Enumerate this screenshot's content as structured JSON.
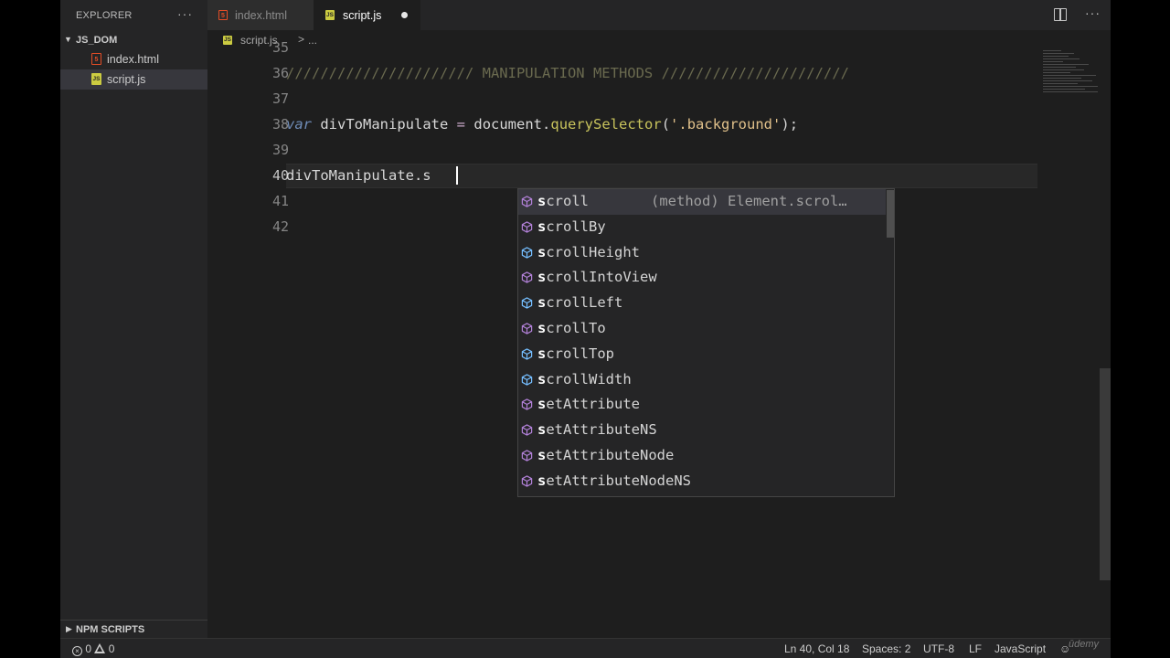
{
  "sidebar": {
    "title": "EXPLORER",
    "more": "···",
    "folder": "JS_DOM",
    "files": [
      {
        "name": "index.html",
        "icon": "html-icon",
        "glyph": "5"
      },
      {
        "name": "script.js",
        "icon": "js-icon",
        "glyph": "JS"
      }
    ],
    "npm_scripts": "NPM SCRIPTS"
  },
  "tabs": [
    {
      "label": "index.html",
      "glyph": "5",
      "active": false
    },
    {
      "label": "script.js",
      "glyph": "JS",
      "active": true,
      "modified": true
    }
  ],
  "tabs_more": "···",
  "breadcrumb": {
    "file": "script.js",
    "glyph": "JS",
    "separator": ">",
    "more": "..."
  },
  "editor": {
    "partial_line_number": "35",
    "lines": [
      {
        "n": "36"
      },
      {
        "n": "37"
      },
      {
        "n": "38"
      },
      {
        "n": "39"
      },
      {
        "n": "40"
      },
      {
        "n": "41"
      },
      {
        "n": "42"
      }
    ],
    "line36_comment": "////////////////////// MANIPULATION METHODS //////////////////////",
    "line38": {
      "kw": "var",
      "name": "divToManipulate",
      "eq": "=",
      "obj": "document",
      "dot": ".",
      "fn": "querySelector",
      "open": "(",
      "str": "'.background'",
      "close": ");"
    },
    "line40": "divToManipulate.s"
  },
  "suggest": {
    "items": [
      {
        "rest": "croll",
        "kind": "method",
        "detail": "(method) Element.scrol…"
      },
      {
        "rest": "crollBy",
        "kind": "method"
      },
      {
        "rest": "crollHeight",
        "kind": "property"
      },
      {
        "rest": "crollIntoView",
        "kind": "method"
      },
      {
        "rest": "crollLeft",
        "kind": "property"
      },
      {
        "rest": "crollTo",
        "kind": "method"
      },
      {
        "rest": "crollTop",
        "kind": "property"
      },
      {
        "rest": "crollWidth",
        "kind": "property"
      },
      {
        "rest": "etAttribute",
        "kind": "method"
      },
      {
        "rest": "etAttributeNS",
        "kind": "method"
      },
      {
        "rest": "etAttributeNode",
        "kind": "method"
      },
      {
        "rest": "etAttributeNodeNS",
        "kind": "method"
      }
    ],
    "match": "s",
    "colors": {
      "method": "#b180d7",
      "property": "#75beff"
    }
  },
  "status": {
    "errors": "0",
    "warnings": "0",
    "position": "Ln 40, Col 18",
    "spaces": "Spaces: 2",
    "encoding": "UTF-8",
    "eol": "LF",
    "language": "JavaScript",
    "watermark": "ūdemy"
  }
}
